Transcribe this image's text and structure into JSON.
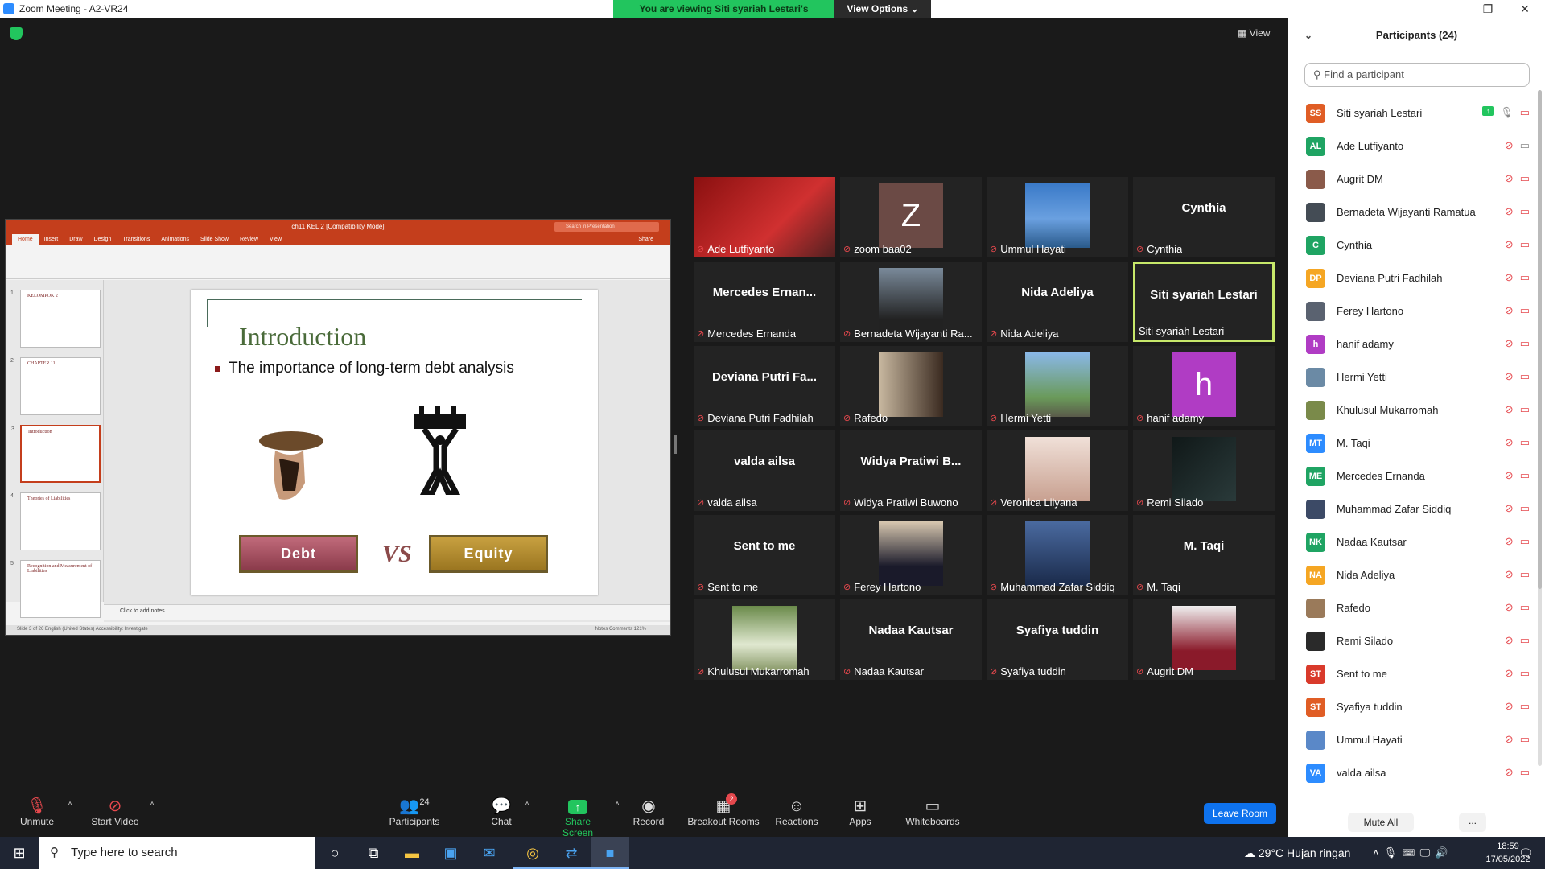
{
  "window": {
    "title": "Zoom Meeting - A2-VR24",
    "viewing_banner": "You are viewing Siti syariah Lestari's screen",
    "view_options": "View Options ⌄",
    "view_button": "View"
  },
  "shared_screen": {
    "ppt_title": "ch11 KEL 2 [Compatibility Mode]",
    "ppt_search": "Search in Presentation",
    "ppt_tabs": [
      "Home",
      "Insert",
      "Draw",
      "Design",
      "Transitions",
      "Animations",
      "Slide Show",
      "Review",
      "View"
    ],
    "share_btn": "Share",
    "slide_title": "Introduction",
    "slide_bullet": "The importance of long-term debt analysis",
    "debt_label": "Debt",
    "vs_label": "VS",
    "equity_label": "Equity",
    "notes_placeholder": "Click to add notes",
    "status_left": "Slide 3 of 26    English (United States)    Accessibility: Investigate",
    "status_right": "Notes    Comments    121%",
    "thumbnails": [
      {
        "num": "1",
        "title": "KELOMPOK 2"
      },
      {
        "num": "2",
        "title": "CHAPTER 11"
      },
      {
        "num": "3",
        "title": "Introduction"
      },
      {
        "num": "4",
        "title": "Theories of Liabilities"
      },
      {
        "num": "5",
        "title": "Recognition and Measurement of Liabilities"
      }
    ]
  },
  "tiles": [
    {
      "name": "Ade Lutfiyanto",
      "big": "",
      "kind": "photo-red"
    },
    {
      "name": "zoom baa02",
      "big": "",
      "kind": "letter-z"
    },
    {
      "name": "Ummul Hayati",
      "big": "",
      "kind": "photo-sea"
    },
    {
      "name": "Cynthia",
      "big": "Cynthia",
      "kind": "text"
    },
    {
      "name": "Mercedes Ernanda",
      "big": "Mercedes  Ernan...",
      "kind": "text"
    },
    {
      "name": "Bernadeta Wijayanti Ra...",
      "big": "",
      "kind": "photo-face"
    },
    {
      "name": "Nida Adeliya",
      "big": "Nida Adeliya",
      "kind": "text"
    },
    {
      "name": "Siti syariah Lestari",
      "big": "Siti syariah Lestari",
      "kind": "text-active"
    },
    {
      "name": "Deviana Putri Fadhilah",
      "big": "Deviana Putri Fa...",
      "kind": "text"
    },
    {
      "name": "Rafedo",
      "big": "",
      "kind": "photo-room"
    },
    {
      "name": "Hermi Yetti",
      "big": "",
      "kind": "photo-outdoor"
    },
    {
      "name": "hanif adamy",
      "big": "",
      "kind": "letter-h"
    },
    {
      "name": "valda ailsa",
      "big": "valda ailsa",
      "kind": "text"
    },
    {
      "name": "Widya Pratiwi Buwono",
      "big": "Widya Pratiwi B...",
      "kind": "text"
    },
    {
      "name": "Veronica Lilyana",
      "big": "",
      "kind": "photo-face-light"
    },
    {
      "name": "Remi Silado",
      "big": "",
      "kind": "photo-dark"
    },
    {
      "name": "Sent to me",
      "big": "Sent to me",
      "kind": "text"
    },
    {
      "name": "Ferey Hartono",
      "big": "",
      "kind": "photo-suit"
    },
    {
      "name": "Muhammad Zafar Siddiq",
      "big": "",
      "kind": "photo-mask"
    },
    {
      "name": "M. Taqi",
      "big": "M. Taqi",
      "kind": "text"
    },
    {
      "name": "Khulusul Mukarromah",
      "big": "",
      "kind": "photo-flowers"
    },
    {
      "name": "Nadaa Kautsar",
      "big": "Nadaa Kautsar",
      "kind": "text"
    },
    {
      "name": "Syafiya tuddin",
      "big": "Syafiya tuddin",
      "kind": "text"
    },
    {
      "name": "Augrit DM",
      "big": "",
      "kind": "photo-hijab"
    }
  ],
  "panel": {
    "title": "Participants (24)",
    "search_placeholder": "Find a participant",
    "mute_all": "Mute All",
    "more": "...",
    "participants": [
      {
        "initials": "SS",
        "name": "Siti syariah Lestari",
        "color": "#e05d25",
        "sharing": true
      },
      {
        "initials": "AL",
        "name": "Ade Lutfiyanto",
        "color": "#1fa463",
        "sharing": false
      },
      {
        "initials": "",
        "name": "Augrit DM",
        "color": "#8a5a4a",
        "sharing": false
      },
      {
        "initials": "",
        "name": "Bernadeta Wijayanti Ramatua",
        "color": "#444c55",
        "sharing": false
      },
      {
        "initials": "C",
        "name": "Cynthia",
        "color": "#1fa463",
        "sharing": false
      },
      {
        "initials": "DP",
        "name": "Deviana Putri Fadhilah",
        "color": "#f5a623",
        "sharing": false
      },
      {
        "initials": "",
        "name": "Ferey Hartono",
        "color": "#5a6270",
        "sharing": false
      },
      {
        "initials": "h",
        "name": "hanif adamy",
        "color": "#b03cc4",
        "sharing": false
      },
      {
        "initials": "",
        "name": "Hermi Yetti",
        "color": "#6b8aa5",
        "sharing": false
      },
      {
        "initials": "",
        "name": "Khulusul Mukarromah",
        "color": "#7a8a4a",
        "sharing": false
      },
      {
        "initials": "MT",
        "name": "M. Taqi",
        "color": "#2d8cff",
        "sharing": false
      },
      {
        "initials": "ME",
        "name": "Mercedes Ernanda",
        "color": "#1fa463",
        "sharing": false
      },
      {
        "initials": "",
        "name": "Muhammad Zafar Siddiq",
        "color": "#3c4a66",
        "sharing": false
      },
      {
        "initials": "NK",
        "name": "Nadaa Kautsar",
        "color": "#1fa463",
        "sharing": false
      },
      {
        "initials": "NA",
        "name": "Nida Adeliya",
        "color": "#f5a623",
        "sharing": false
      },
      {
        "initials": "",
        "name": "Rafedo",
        "color": "#9a7a5a",
        "sharing": false
      },
      {
        "initials": "",
        "name": "Remi Silado",
        "color": "#2a2a2a",
        "sharing": false
      },
      {
        "initials": "ST",
        "name": "Sent to me",
        "color": "#d93a2b",
        "sharing": false
      },
      {
        "initials": "ST",
        "name": "Syafiya tuddin",
        "color": "#e05d25",
        "sharing": false
      },
      {
        "initials": "",
        "name": "Ummul Hayati",
        "color": "#5a88c8",
        "sharing": false
      },
      {
        "initials": "VA",
        "name": "valda ailsa",
        "color": "#2d8cff",
        "sharing": false
      }
    ]
  },
  "toolbar": {
    "unmute": "Unmute",
    "start_video": "Start Video",
    "participants": "Participants",
    "participants_count": "24",
    "chat": "Chat",
    "share_screen": "Share Screen",
    "record": "Record",
    "breakout": "Breakout Rooms",
    "breakout_badge": "2",
    "reactions": "Reactions",
    "apps": "Apps",
    "whiteboards": "Whiteboards",
    "leave": "Leave Room"
  },
  "taskbar": {
    "search_placeholder": "Type here to search",
    "weather": "29°C  Hujan ringan",
    "time": "18:59",
    "date": "17/05/2022"
  }
}
